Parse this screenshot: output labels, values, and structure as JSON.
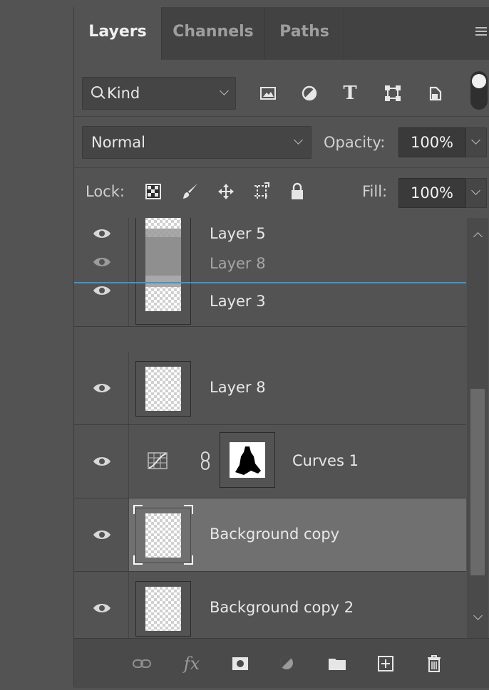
{
  "tabs": [
    {
      "label": "Layers",
      "active": true
    },
    {
      "label": "Channels",
      "active": false
    },
    {
      "label": "Paths",
      "active": false
    }
  ],
  "filter": {
    "kind_label": "Kind",
    "icons": [
      "pixel-layer-filter-icon",
      "adjustment-layer-filter-icon",
      "type-layer-filter-icon",
      "shape-layer-filter-icon",
      "smart-object-filter-icon"
    ],
    "type_filter_glyph": "T",
    "filter_toggle_on": true
  },
  "blend": {
    "mode": "Normal",
    "opacity_label": "Opacity:",
    "opacity_value": "100%"
  },
  "lock": {
    "label": "Lock:",
    "icons": [
      "lock-transparent-pixels-icon",
      "lock-image-pixels-icon",
      "lock-position-icon",
      "lock-artboard-icon",
      "lock-all-icon"
    ],
    "fill_label": "Fill:",
    "fill_value": "100%"
  },
  "layers": [
    {
      "name": "Layer 5",
      "visible": true,
      "selected": false
    },
    {
      "name": "Layer 8",
      "visible": true,
      "selected": false,
      "drag_ghost": true
    },
    {
      "name": "Layer 3",
      "visible": true,
      "selected": false
    },
    {
      "name": "Layer 8",
      "visible": true,
      "selected": false
    },
    {
      "name": "Curves 1",
      "visible": true,
      "selected": false,
      "type": "adjustment"
    },
    {
      "name": "Background copy",
      "visible": true,
      "selected": true
    },
    {
      "name": "Background copy 2",
      "visible": true,
      "selected": false
    }
  ],
  "bottom_icons": [
    "link-layers-icon",
    "fx-icon",
    "add-mask-icon",
    "new-fill-adjustment-icon",
    "new-group-icon",
    "new-layer-icon",
    "delete-layer-icon"
  ],
  "bottom_fx_label": "fx",
  "colors": {
    "panel_bg": "#535353",
    "selected_row": "#707070",
    "drop_indicator": "#3f97c8"
  }
}
